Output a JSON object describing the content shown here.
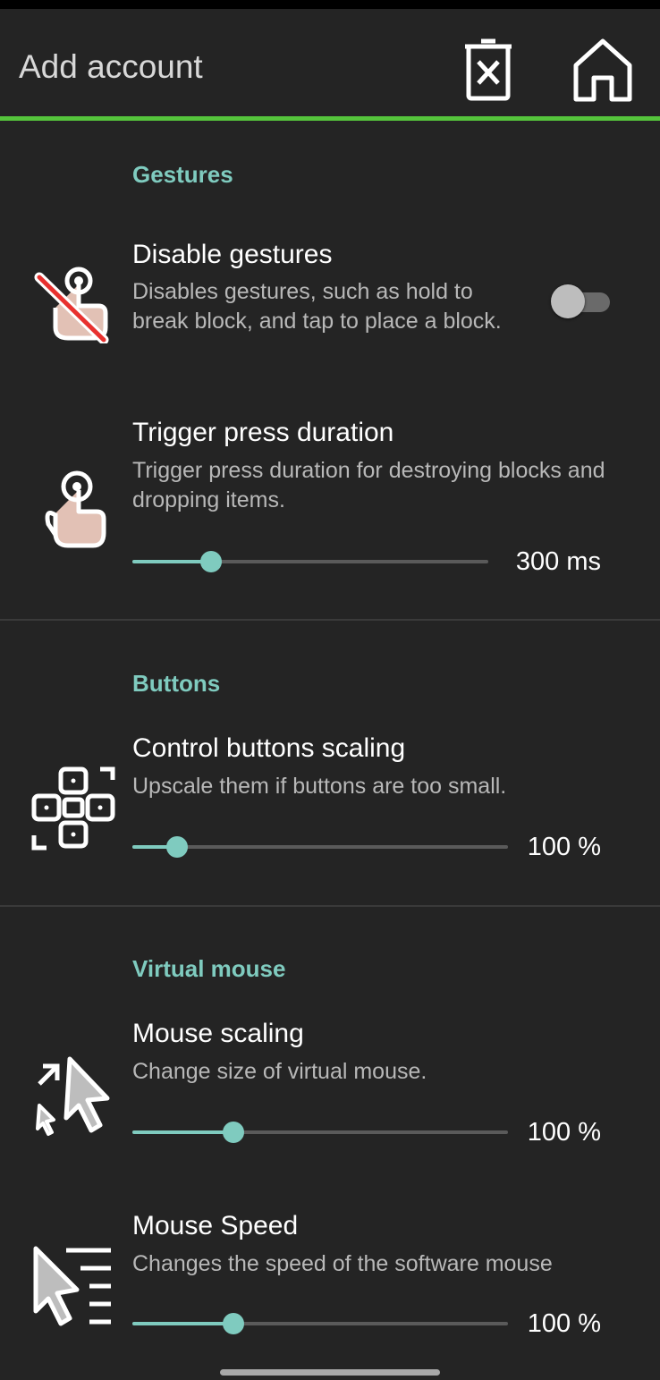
{
  "appbar": {
    "title": "Add account",
    "delete_icon": "trash-x-icon",
    "home_icon": "home-icon"
  },
  "colors": {
    "background": "#242424",
    "accent_line": "#55c43c",
    "section_title": "#7fcbbf",
    "slider": "#7fcbbf"
  },
  "sections": {
    "gestures": {
      "title": "Gestures",
      "disable_gestures": {
        "icon": "disabled-touch-icon",
        "title": "Disable gestures",
        "summary": "Disables gestures, such as hold to break block, and tap to place a block.",
        "enabled": false
      },
      "trigger_press": {
        "icon": "touch-hand-icon",
        "title": "Trigger press duration",
        "summary": "Trigger press duration for destroying blocks and dropping items.",
        "value_label": "300 ms",
        "fraction": 0.22
      }
    },
    "buttons": {
      "title": "Buttons",
      "control_scaling": {
        "icon": "gamepad-buttons-icon",
        "title": "Control buttons scaling",
        "summary": "Upscale them if buttons are too small.",
        "value_label": "100 %",
        "fraction": 0.12
      }
    },
    "virtual_mouse": {
      "title": "Virtual mouse",
      "mouse_scaling": {
        "icon": "resize-pointer-icon",
        "title": "Mouse scaling",
        "summary": "Change size of virtual mouse.",
        "value_label": "100 %",
        "fraction": 0.27
      },
      "mouse_speed": {
        "icon": "pointer-speed-icon",
        "title": "Mouse Speed",
        "summary": "Changes the speed of the software mouse",
        "value_label": "100 %",
        "fraction": 0.27
      }
    }
  }
}
